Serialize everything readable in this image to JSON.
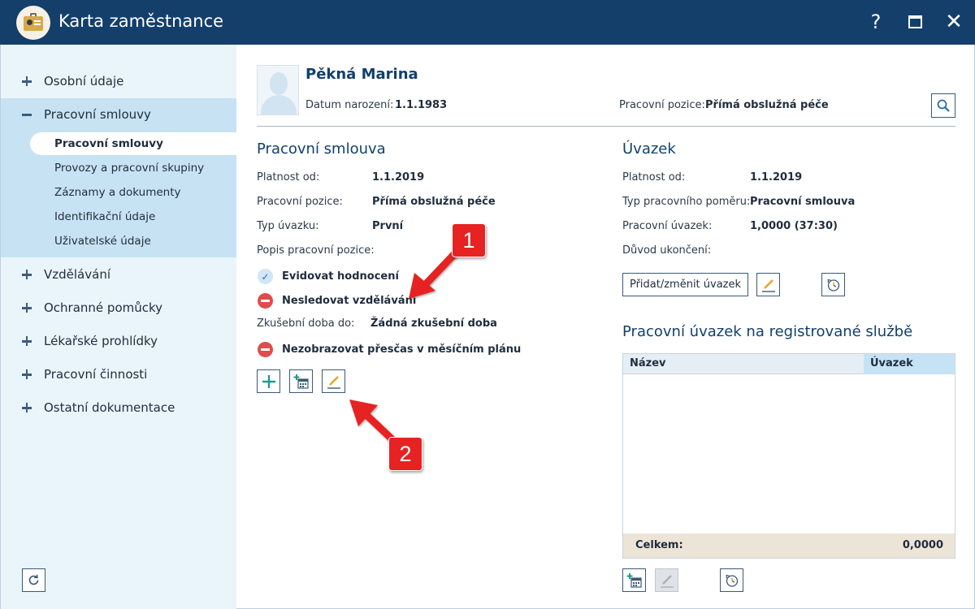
{
  "window": {
    "title": "Karta zaměstnance",
    "help_label": "?",
    "close_label": "✕"
  },
  "sidebar": {
    "items": [
      {
        "label": "Osobní údaje",
        "expanded": false
      },
      {
        "label": "Pracovní smlouvy",
        "expanded": true
      },
      {
        "label": "Vzdělávání",
        "expanded": false
      },
      {
        "label": "Ochranné pomůcky",
        "expanded": false
      },
      {
        "label": "Lékařské prohlídky",
        "expanded": false
      },
      {
        "label": "Pracovní činnosti",
        "expanded": false
      },
      {
        "label": "Ostatní dokumentace",
        "expanded": false
      }
    ],
    "subitems": [
      {
        "label": "Pracovní smlouvy",
        "active": true
      },
      {
        "label": "Provozy a pracovní skupiny",
        "active": false
      },
      {
        "label": "Záznamy a dokumenty",
        "active": false
      },
      {
        "label": "Identifikační údaje",
        "active": false
      },
      {
        "label": "Uživatelské údaje",
        "active": false
      }
    ],
    "refresh_icon": "refresh-icon"
  },
  "employee": {
    "name": "Pěkná Marina",
    "birth_label": "Datum narození:",
    "birth_value": "1.1.1983",
    "position_label": "Pracovní pozice:",
    "position_value": "Přímá obslužná péče"
  },
  "contract": {
    "title": "Pracovní smlouva",
    "fields": [
      {
        "label": "Platnost od:",
        "value": "1.1.2019"
      },
      {
        "label": "Pracovní pozice:",
        "value": "Přímá obslužná péče"
      },
      {
        "label": "Typ úvazku:",
        "value": "První"
      },
      {
        "label": "Popis pracovní pozice:",
        "value": ""
      }
    ],
    "status": [
      {
        "label": "Evidovat hodnocení",
        "icon": "check-icon"
      },
      {
        "label": "Nesledovat vzdělávání",
        "icon": "minus-circle-icon"
      }
    ],
    "probation_label": "Zkušební doba do:",
    "probation_value": "Žádná zkušební doba",
    "overtime_label": "Nezobrazovat přesčas v měsíčním plánu"
  },
  "workload": {
    "title": "Úvazek",
    "fields": [
      {
        "label": "Platnost od:",
        "value": "1.1.2019"
      },
      {
        "label": "Typ pracovního poměru:",
        "value": "Pracovní smlouva"
      },
      {
        "label": "Pracovní úvazek:",
        "value": "1,0000 (37:30)"
      },
      {
        "label": "Důvod ukončení:",
        "value": ""
      }
    ],
    "add_change_button": "Přidat/změnit úvazek"
  },
  "registered": {
    "title": "Pracovní úvazek na registrované službě",
    "columns": [
      "Název",
      "Úvazek"
    ],
    "rows": [],
    "total_label": "Celkem:",
    "total_value": "0,0000"
  },
  "annotations": {
    "callout_1": "1",
    "callout_2": "2",
    "color": "#e62222"
  },
  "colors": {
    "titlebar": "#143f6b",
    "sidebar": "#eaf4fb",
    "sidebar_open": "#c7e3f3",
    "accent": "#12406d"
  }
}
